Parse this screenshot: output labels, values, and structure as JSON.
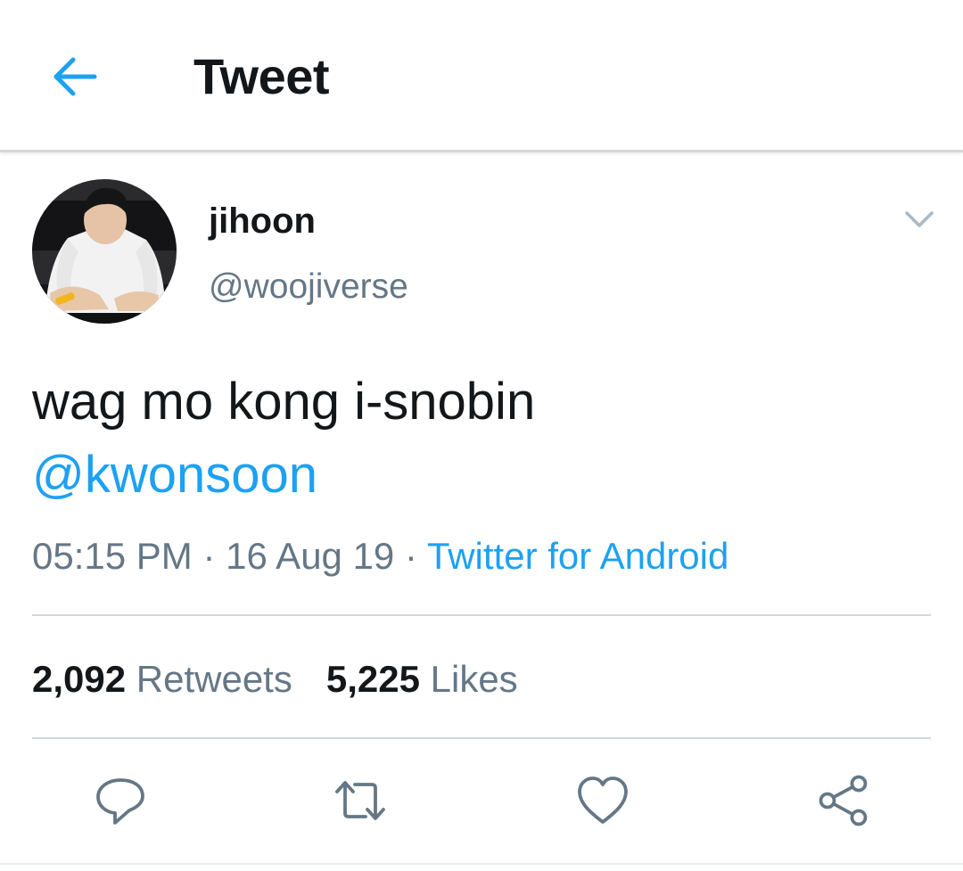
{
  "header": {
    "title": "Tweet",
    "back_icon": "back-arrow-icon"
  },
  "tweet": {
    "author": {
      "display_name": "jihoon",
      "handle": "@woojiverse",
      "avatar": "profile-photo"
    },
    "text": "wag mo kong i-snobin",
    "mention": "@kwonsoon",
    "time": "05:15 PM",
    "sep1": " · ",
    "date": "16 Aug 19",
    "sep2": " · ",
    "source": "Twitter for Android",
    "stats": {
      "retweets_count": "2,092",
      "retweets_label": " Retweets",
      "likes_count": "5,225",
      "likes_label": " Likes"
    },
    "actions": [
      "reply-icon",
      "retweet-icon",
      "like-icon",
      "share-icon"
    ]
  },
  "colors": {
    "accent": "#1da1f2",
    "text": "#14171a",
    "muted": "#657786",
    "divider": "#d2d7dc"
  }
}
